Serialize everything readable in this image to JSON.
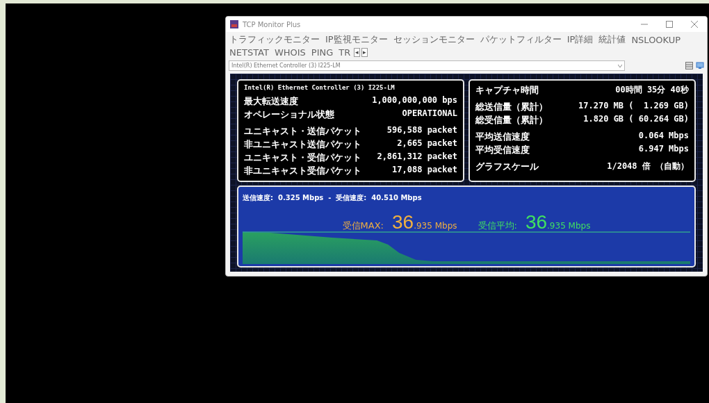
{
  "window": {
    "title": "TCP Monitor Plus"
  },
  "menu": [
    {
      "label": "トラフィックモニター"
    },
    {
      "label": "IP監視モニター"
    },
    {
      "label": "セッションモニター"
    },
    {
      "label": "パケットフィルター"
    },
    {
      "label": "IP詳細"
    },
    {
      "label": "統計値"
    },
    {
      "label": "NSLOOKUP"
    },
    {
      "label": "NETSTAT"
    },
    {
      "label": "WHOIS"
    },
    {
      "label": "PING"
    },
    {
      "label": "TR"
    }
  ],
  "menu_scroll": [
    "◂",
    "▸"
  ],
  "adapter_select": {
    "value": "Intel(R) Ethernet Controller (3) I225-LM"
  },
  "adapter_panel": {
    "title": "Intel(R) Ethernet Controller (3) I225-LM",
    "groups": [
      [
        {
          "label": "最大転送速度",
          "value": "1,000,000,000 bps"
        },
        {
          "label": "オペレーショナル状態",
          "value": "OPERATIONAL"
        }
      ],
      [
        {
          "label": "ユニキャスト・送信パケット",
          "value": "596,588 packet"
        },
        {
          "label": "非ユニキャスト送信パケット",
          "value": "2,665 packet"
        },
        {
          "label": "ユニキャスト・受信パケット",
          "value": "2,861,312 packet"
        },
        {
          "label": "非ユニキャスト受信パケット",
          "value": "17,088 packet"
        }
      ]
    ]
  },
  "capture_panel": {
    "groups": [
      [
        {
          "label": "キャプチャ時間",
          "value": "00時間 35分 40秒"
        }
      ],
      [
        {
          "label": "総送信量（累計）",
          "value": "17.270 MB (  1.269 GB)"
        },
        {
          "label": "総受信量（累計）",
          "value": "1.820 GB ( 60.264 GB)"
        }
      ],
      [
        {
          "label": "平均送信速度",
          "value": "0.064 Mbps"
        },
        {
          "label": "平均受信速度",
          "value": "6.947 Mbps"
        }
      ],
      [
        {
          "label": "グラフスケール",
          "value": "1/2048 倍 （自動）"
        }
      ]
    ]
  },
  "graph": {
    "speed_line": "送信速度:  0.325 Mbps  -  受信速度:  40.510 Mbps",
    "readouts": [
      {
        "label": "受信MAX:",
        "whole": "36",
        "fraction": ".935 Mbps",
        "color": "#f0b040"
      },
      {
        "label": "受信平均:",
        "whole": "36",
        "fraction": ".935 Mbps",
        "color": "#40e060"
      }
    ]
  }
}
